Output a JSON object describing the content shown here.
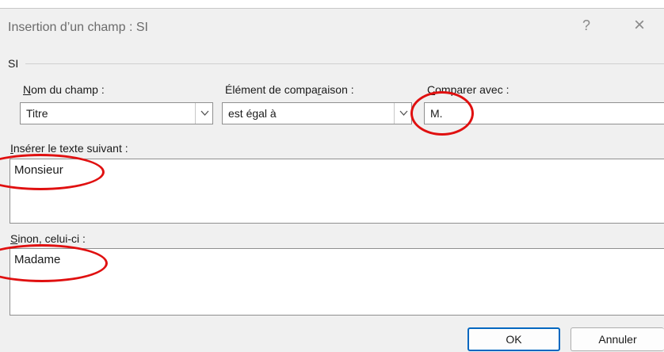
{
  "dialog": {
    "title": "Insertion d’un champ : SI",
    "help": "?",
    "close": "×"
  },
  "group": {
    "label": "SI"
  },
  "fields": {
    "nom_du_champ": {
      "label_pre": "",
      "label_key": "N",
      "label_post": "om du champ :",
      "value": "Titre"
    },
    "comparaison": {
      "label_pre": "Élément de compa",
      "label_key": "r",
      "label_post": "aison :",
      "value": "est égal à"
    },
    "comparer_avec": {
      "label_pre": "",
      "label_key": "C",
      "label_post": "omparer avec :",
      "value": "M."
    }
  },
  "inserer": {
    "label_pre": "",
    "label_key": "I",
    "label_post": "nsérer le texte suivant :",
    "value": "Monsieur"
  },
  "sinon": {
    "label_pre": "",
    "label_key": "S",
    "label_post": "inon, celui-ci :",
    "value": "Madame"
  },
  "buttons": {
    "ok": "OK",
    "cancel": "Annuler"
  },
  "colors": {
    "annotation": "#e01010",
    "accent": "#0067c0"
  }
}
